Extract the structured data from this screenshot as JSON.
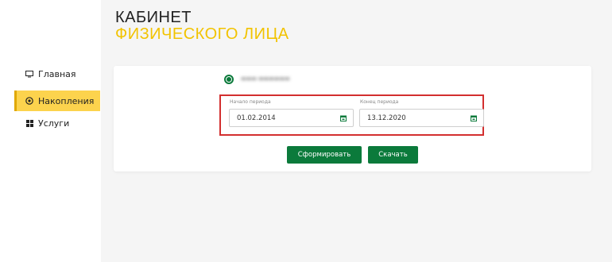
{
  "header": {
    "title_line1": "КАБИНЕТ",
    "title_line2": "ФИЗИЧЕСКОГО ЛИЦА"
  },
  "sidebar": {
    "items": [
      {
        "label": "Главная",
        "icon": "monitor-icon",
        "active": false
      },
      {
        "label": "Накопления",
        "icon": "coins-icon",
        "active": true
      },
      {
        "label": "Услуги",
        "icon": "grid-icon",
        "active": false
      }
    ]
  },
  "form": {
    "radio_selected": true,
    "period_start": {
      "label": "Начало периода",
      "value": "01.02.2014"
    },
    "period_end": {
      "label": "Конец периода",
      "value": "13.12.2020"
    },
    "generate_label": "Сформировать",
    "download_label": "Скачать"
  },
  "colors": {
    "accent": "#0b7a3b",
    "brand_yellow": "#f2c300",
    "highlight": "#d32f2f"
  }
}
